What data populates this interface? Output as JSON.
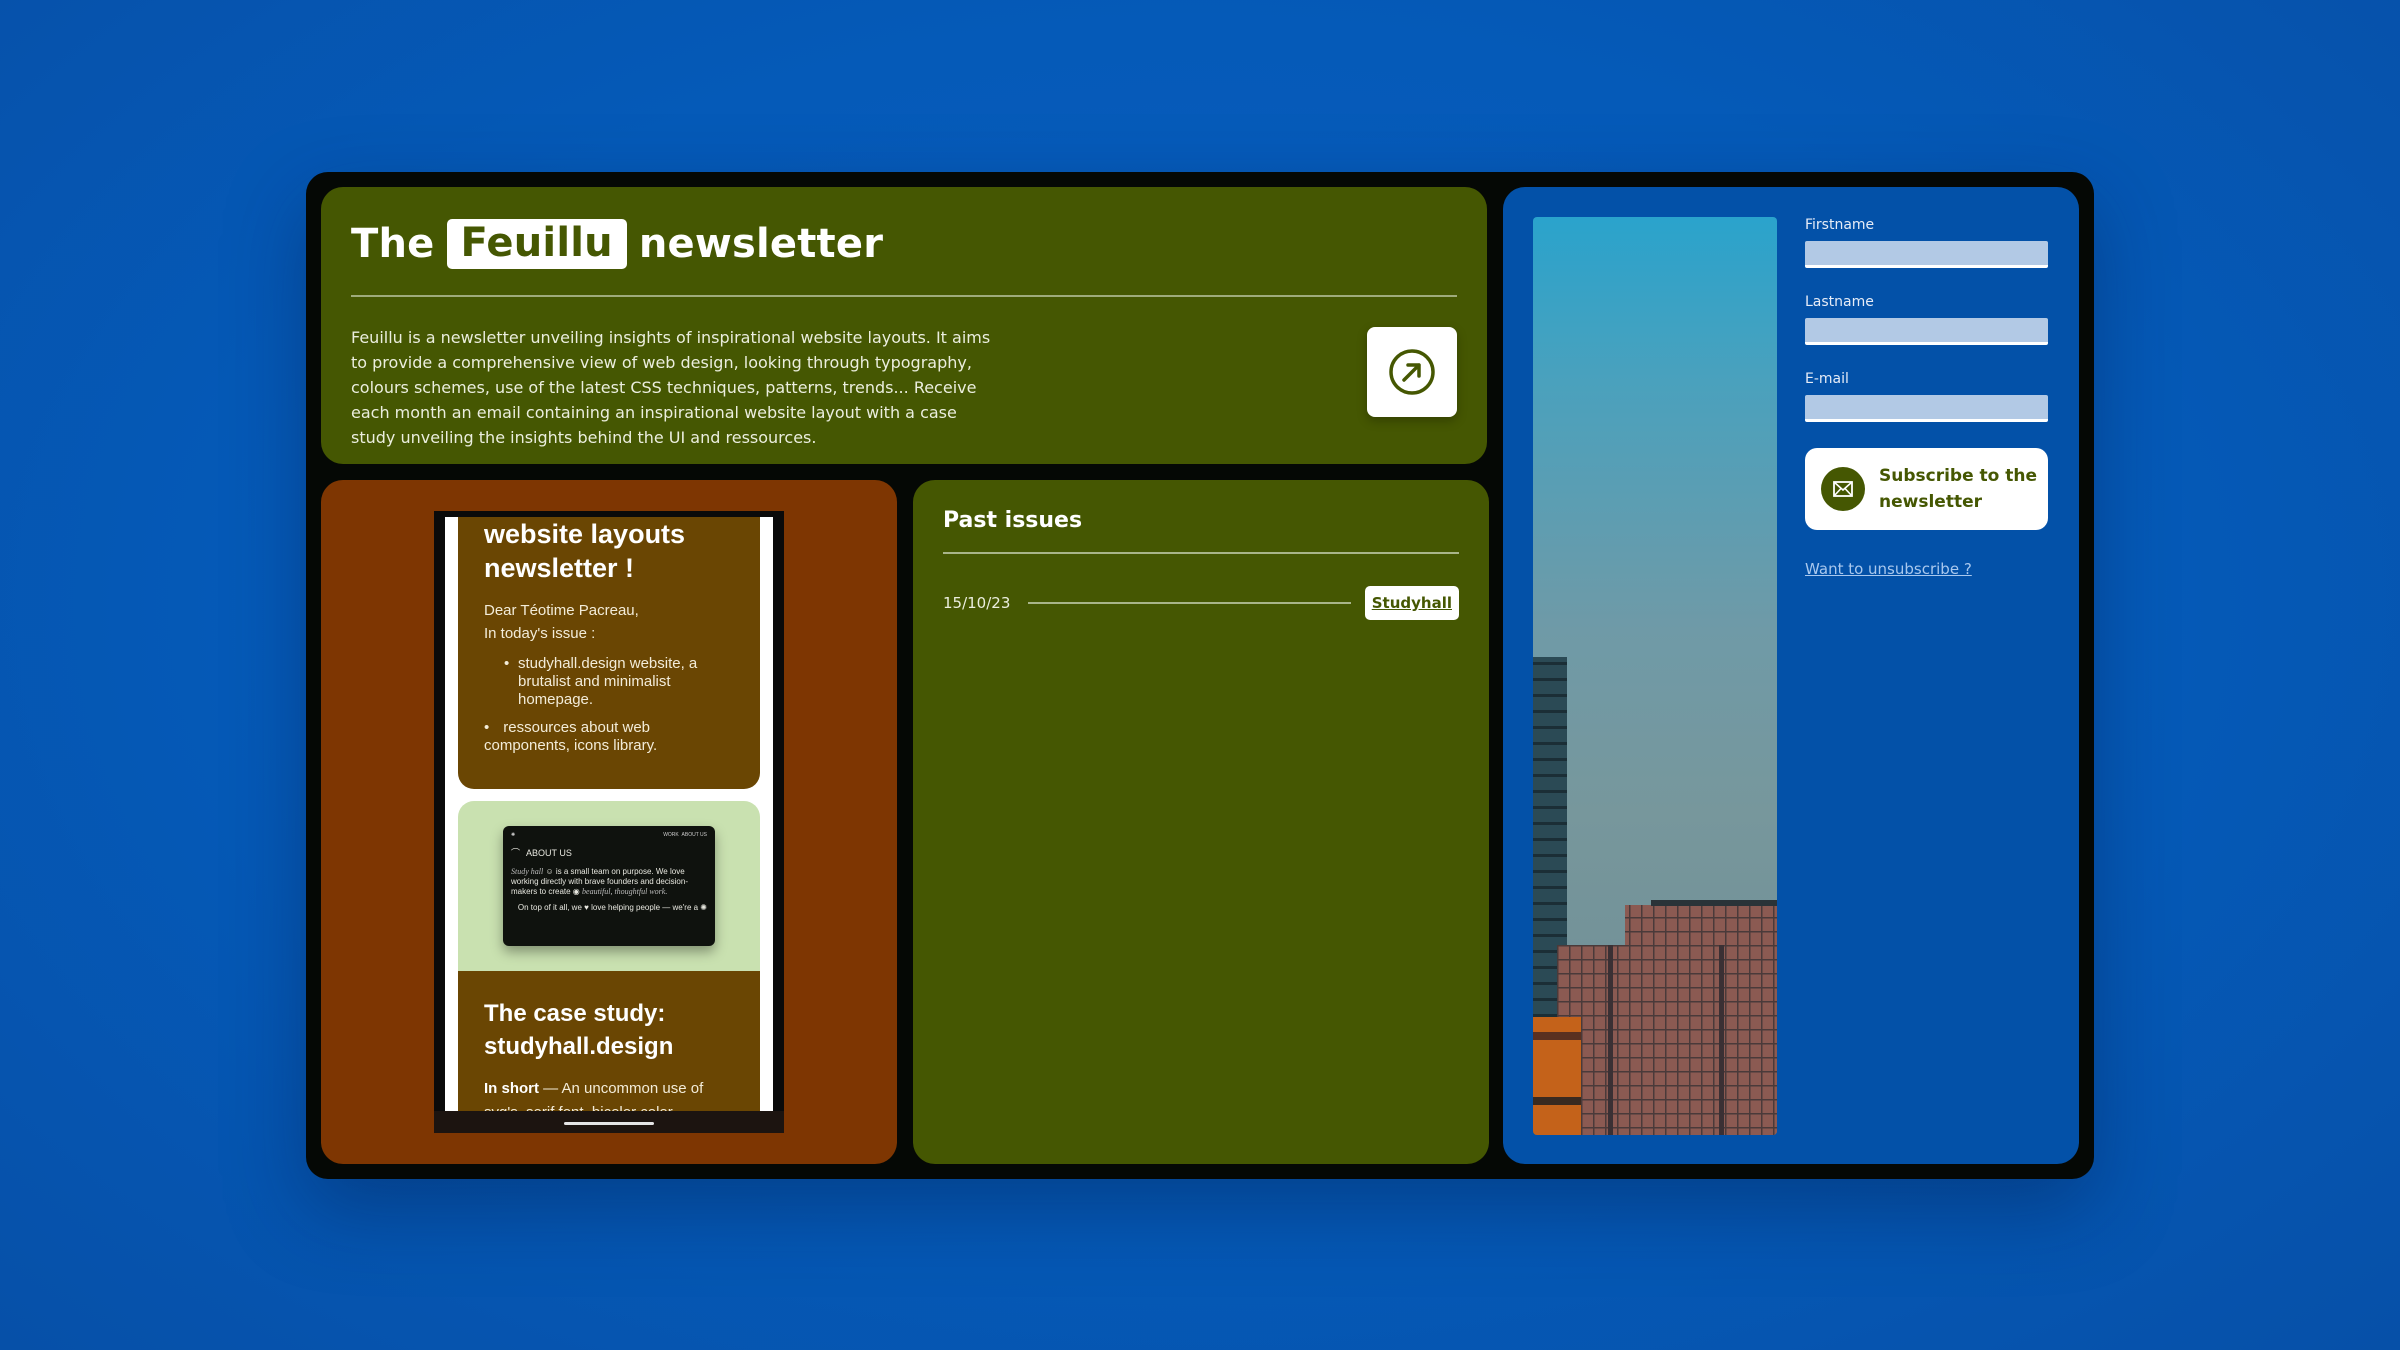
{
  "header": {
    "title_before": "The",
    "brand": "Feuillu",
    "title_after": "newsletter",
    "description": "Feuillu is a newsletter unveiling insights of inspirational website layouts. It aims to provide a comprehensive view of web design, looking through typography, colours schemes, use of the latest CSS techniques, patterns, trends... Receive each month an email containing an inspirational website layout with a case study unveiling the insights behind the UI and ressources.",
    "open_button_icon": "arrow-up-right-circle-icon"
  },
  "preview": {
    "heading": "website layouts newsletter !",
    "greeting": "Dear Téotime Pacreau,",
    "intro": "In today's issue :",
    "items": [
      "studyhall.design website, a brutalist and minimalist homepage.",
      "ressources about web components, icons library."
    ],
    "site_shot": {
      "nav": [
        "WORK",
        "ABOUT US"
      ],
      "section": "ABOUT US",
      "body_serif": "Study hall",
      "body_text": "is a small team on purpose. We love working directly with brave founders and decision-makers to create",
      "body_serif_end": "beautiful, thoughtful work.",
      "footer_text": "On top of it all, we",
      "footer_serif": "love helping people",
      "footer_end": "— we're a"
    },
    "case_heading": "The case study: studyhall.design",
    "case_lead": "In short",
    "case_text": "— An uncommon use of svg's, serif font, bicolor color"
  },
  "past_issues": {
    "title": "Past issues",
    "issues": [
      {
        "date": "15/10/23",
        "name": "Studyhall"
      }
    ]
  },
  "subscribe": {
    "fields": [
      {
        "label": "Firstname",
        "value": ""
      },
      {
        "label": "Lastname",
        "value": ""
      },
      {
        "label": "E-mail",
        "value": ""
      }
    ],
    "button_label": "Subscribe to the newsletter",
    "unsubscribe_link": "Want to unsubscribe ?"
  },
  "colors": {
    "background": "#055ab8",
    "olive": "#455702",
    "rust": "#7e3602",
    "blue_panel": "#0351a8",
    "frame": "#050805"
  }
}
